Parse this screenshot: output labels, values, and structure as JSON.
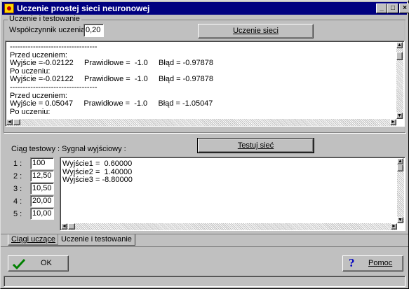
{
  "window": {
    "title": "Uczenie prostej sieci neuronowej"
  },
  "group": {
    "legend": "Uczenie i testowanie",
    "coef_label": "Współczynnik uczenia:",
    "coef_value": "0,20",
    "train_button": "Uczenie sieci"
  },
  "log": {
    "lines": [
      "----------------------------------",
      "Przed uczeniem:",
      "Wyjście =-0.02122     Prawidłowe =  -1.0     Błąd = -0.97878",
      "Po uczeniu:",
      "Wyjście =-0.02122     Prawidłowe =  -1.0     Błąd = -0.97878",
      "----------------------------------",
      "Przed uczeniem:",
      "Wyjście = 0.05047     Prawidłowe =  -1.0     Błąd = -1.05047",
      "Po uczeniu:"
    ]
  },
  "test": {
    "sequence_label": "Ciąg testowy :",
    "signal_label": "Sygnał wyjściowy :",
    "test_button": "Testuj sieć",
    "rows": [
      {
        "label": "1 :",
        "value": "100"
      },
      {
        "label": "2 :",
        "value": "12,50"
      },
      {
        "label": "3 :",
        "value": "10,50"
      },
      {
        "label": "4 :",
        "value": "20,00"
      },
      {
        "label": "5 :",
        "value": "10,00"
      }
    ],
    "outputs": [
      "Wyjście1 =  0.60000",
      "Wyjście2 =  1.40000",
      "Wyjście3 = -8.80000"
    ]
  },
  "tabs": [
    {
      "label": "Ciągi uczące",
      "active": true
    },
    {
      "label": "Uczenie i testowanie",
      "active": false
    }
  ],
  "footer": {
    "ok_label": "OK",
    "help_label": "Pomoc"
  },
  "icons": {
    "app": "neural-app-icon",
    "ok": "checkmark-icon",
    "help": "question-mark-icon"
  }
}
